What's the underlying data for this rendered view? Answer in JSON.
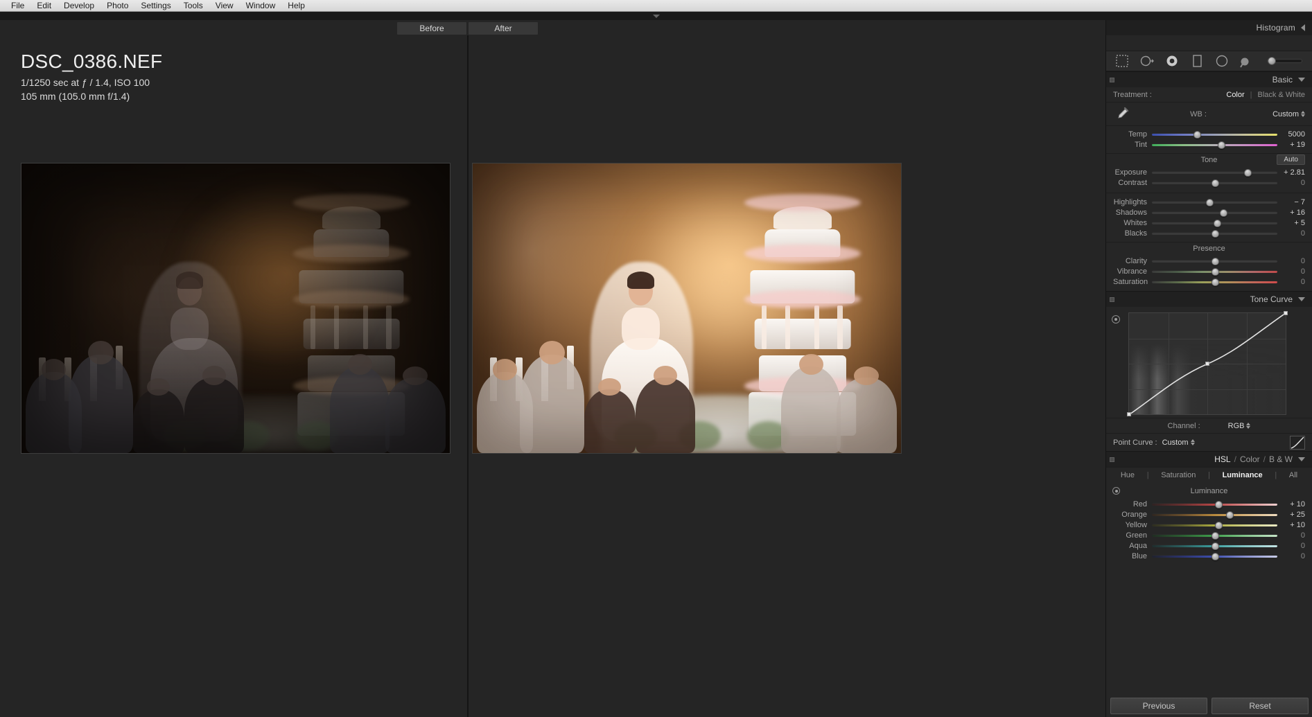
{
  "menubar": {
    "items": [
      {
        "label": "File"
      },
      {
        "label": "Edit"
      },
      {
        "label": "Develop"
      },
      {
        "label": "Photo"
      },
      {
        "label": "Settings"
      },
      {
        "label": "Tools"
      },
      {
        "label": "View"
      },
      {
        "label": "Window"
      },
      {
        "label": "Help"
      }
    ]
  },
  "photo_info": {
    "filename": "DSC_0386.NEF",
    "exposure": "1/1250 sec at ƒ / 1.4, ISO 100",
    "lens": "105 mm (105.0 mm f/1.4)"
  },
  "view": {
    "before_label": "Before",
    "after_label": "After"
  },
  "histogram": {
    "title": "Histogram",
    "tools": [
      {
        "name": "crop-overlay-tool"
      },
      {
        "name": "spot-removal-tool"
      },
      {
        "name": "red-eye-correction-tool"
      },
      {
        "name": "graduated-filter-tool"
      },
      {
        "name": "radial-filter-tool"
      },
      {
        "name": "adjustment-brush-tool"
      }
    ]
  },
  "basic": {
    "title": "Basic",
    "treatment_label": "Treatment :",
    "treatment_color": "Color",
    "treatment_bw": "Black & White",
    "wb_label": "WB :",
    "wb_value": "Custom",
    "wb_sliders": [
      {
        "label": "Temp",
        "value": "5000",
        "pos": 36,
        "grad": "grad-temp",
        "zero": false
      },
      {
        "label": "Tint",
        "value": "+ 19",
        "pos": 55,
        "grad": "grad-tint",
        "zero": false
      }
    ],
    "tone_label": "Tone",
    "auto_label": "Auto",
    "tone_sliders": [
      {
        "label": "Exposure",
        "value": "+ 2.81",
        "pos": 76,
        "grad": "",
        "zero": false
      },
      {
        "label": "Contrast",
        "value": "0",
        "pos": 50,
        "grad": "",
        "zero": true
      }
    ],
    "tone_sliders2": [
      {
        "label": "Highlights",
        "value": "− 7",
        "pos": 46,
        "grad": "",
        "zero": false
      },
      {
        "label": "Shadows",
        "value": "+ 16",
        "pos": 57,
        "grad": "",
        "zero": false
      },
      {
        "label": "Whites",
        "value": "+ 5",
        "pos": 52,
        "grad": "",
        "zero": false
      },
      {
        "label": "Blacks",
        "value": "0",
        "pos": 50,
        "grad": "",
        "zero": true
      }
    ],
    "presence_label": "Presence",
    "presence_sliders": [
      {
        "label": "Clarity",
        "value": "0",
        "pos": 50,
        "grad": "",
        "zero": true
      },
      {
        "label": "Vibrance",
        "value": "0",
        "pos": 50,
        "grad": "grad-vib",
        "zero": true
      },
      {
        "label": "Saturation",
        "value": "0",
        "pos": 50,
        "grad": "grad-sat",
        "zero": true
      }
    ]
  },
  "tone_curve": {
    "title": "Tone Curve",
    "channel_label": "Channel :",
    "channel_value": "RGB",
    "point_curve_label": "Point Curve :",
    "point_curve_value": "Custom"
  },
  "hsl": {
    "title_hsl": "HSL",
    "title_color": "Color",
    "title_bw": "B & W",
    "sep": "/",
    "tabs": [
      {
        "label": "Hue",
        "active": false
      },
      {
        "label": "Saturation",
        "active": false
      },
      {
        "label": "Luminance",
        "active": true
      },
      {
        "label": "All",
        "active": false
      }
    ],
    "subhead": "Luminance",
    "sliders": [
      {
        "label": "Red",
        "value": "+ 10",
        "pos": 53,
        "grad": "grad-red",
        "zero": false
      },
      {
        "label": "Orange",
        "value": "+ 25",
        "pos": 62,
        "grad": "grad-orange",
        "zero": false
      },
      {
        "label": "Yellow",
        "value": "+ 10",
        "pos": 53,
        "grad": "grad-yellow",
        "zero": false
      },
      {
        "label": "Green",
        "value": "0",
        "pos": 50,
        "grad": "grad-green",
        "zero": true
      },
      {
        "label": "Aqua",
        "value": "0",
        "pos": 50,
        "grad": "grad-aqua",
        "zero": true
      },
      {
        "label": "Blue",
        "value": "0",
        "pos": 50,
        "grad": "grad-blue",
        "zero": true
      }
    ]
  },
  "footer": {
    "previous_label": "Previous",
    "reset_label": "Reset"
  }
}
